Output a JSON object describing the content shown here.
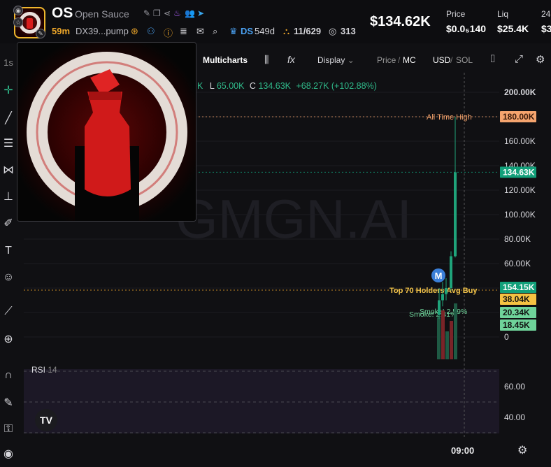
{
  "header": {
    "symbol": "OS",
    "name": "Open Sauce",
    "age": "59m",
    "contract": "DX39...pump",
    "dev_label": "DS",
    "dev_age": "549d",
    "holders_ratio": "11/629",
    "views": "313",
    "price_big": "$134.62K",
    "stats": [
      {
        "label": "Price",
        "value": "$0.0₅140"
      },
      {
        "label": "Liq",
        "value": "$25.4K"
      },
      {
        "label": "24",
        "value": "$3"
      }
    ]
  },
  "left_toolbar_tab": "1s",
  "chart_toolbar": {
    "multicharts": "Multicharts",
    "indicators_icon": "fx",
    "display": "Display",
    "price_label": "Price",
    "mc_label": "MC",
    "usd_label": "USD",
    "sol_label": "SOL"
  },
  "ohlc": {
    "l_label": "L",
    "l_value": "65.00K",
    "c_label": "C",
    "c_value": "134.63K",
    "change": "+68.27K (+102.88%)",
    "prefix": "K"
  },
  "watermark": "GMGN.AI",
  "chart_data": {
    "type": "candlestick",
    "y_ticks": [
      "200.00K",
      "160.00K",
      "140.00K",
      "120.00K",
      "100.00K",
      "80.00K",
      "60.00K",
      "0"
    ],
    "price_labels": [
      {
        "text": "180.00K",
        "color": "#f0a06a",
        "bg": "#f5a46e"
      },
      {
        "text": "134.63K",
        "color": "#ffffff",
        "bg": "#12a07a"
      },
      {
        "text": "154.15K",
        "color": "#ffffff",
        "bg": "#12a07a"
      },
      {
        "text": "38.04K",
        "color": "#111111",
        "bg": "#f5c242"
      },
      {
        "text": "20.34K",
        "color": "#111111",
        "bg": "#6fd39a"
      },
      {
        "text": "18.45K",
        "color": "#111111",
        "bg": "#6fd39a"
      }
    ],
    "annotations": [
      {
        "text": "All Time High",
        "color": "#f0a06a"
      },
      {
        "text": "Top 70 Holders Avg Buy",
        "color": "#f0c24a"
      },
      {
        "text": "Smoke! 2.59%",
        "color": "#6fd39a"
      },
      {
        "text": "Smoke! 2.41%",
        "color": "#6fd39a"
      }
    ],
    "marker": "M",
    "ylim": [
      0,
      200000
    ],
    "candles": [
      {
        "o": 18000,
        "h": 40000,
        "l": 15000,
        "c": 30000
      },
      {
        "o": 30000,
        "h": 45000,
        "l": 25000,
        "c": 35000
      },
      {
        "o": 35000,
        "h": 48000,
        "l": 30000,
        "c": 40000
      },
      {
        "o": 40000,
        "h": 70000,
        "l": 38000,
        "c": 66000
      },
      {
        "o": 66000,
        "h": 180000,
        "l": 65000,
        "c": 134630
      }
    ],
    "volumes": [
      60,
      70,
      40,
      55,
      80
    ],
    "x_label": "09:00"
  },
  "rsi": {
    "label": "RSI",
    "period": "14",
    "ticks": [
      "60.00",
      "40.00"
    ]
  },
  "tv_logo": "TV",
  "colors": {
    "up": "#1fa37a",
    "down": "#e0444a",
    "accent": "#f0a82a"
  }
}
